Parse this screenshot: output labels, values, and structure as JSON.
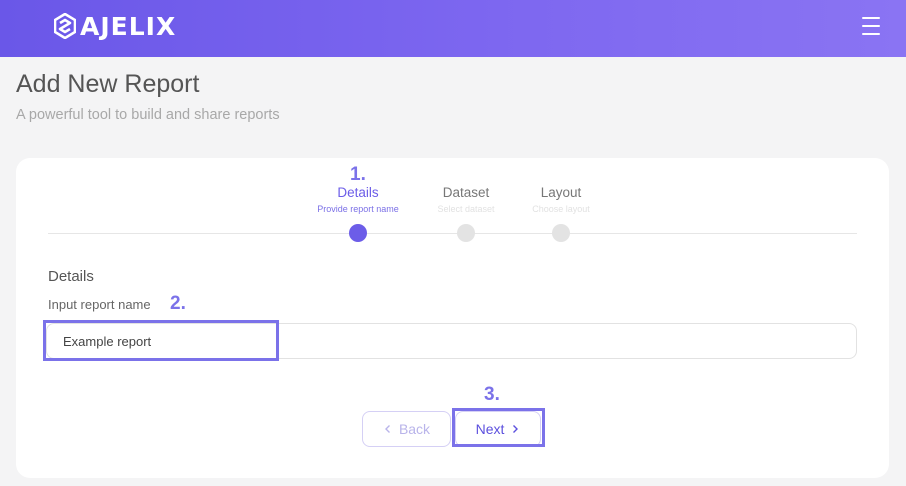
{
  "header": {
    "logo_text": "AJELIX",
    "menu_icon": "hamburger-menu-icon",
    "accent_color": "#6c5de8"
  },
  "page": {
    "title": "Add New Report",
    "subtitle": "A powerful tool to build and share reports"
  },
  "steps": [
    {
      "annotation": "1.",
      "title": "Details",
      "subtitle": "Provide report name",
      "active": true
    },
    {
      "title": "Dataset",
      "subtitle": "Select dataset",
      "active": false
    },
    {
      "title": "Layout",
      "subtitle": "Choose layout",
      "active": false
    }
  ],
  "form": {
    "section_heading": "Details",
    "field_label": "Input report name",
    "field_annotation": "2.",
    "report_name_value": "Example report"
  },
  "actions": {
    "annotation": "3.",
    "back_label": "Back",
    "next_label": "Next"
  }
}
